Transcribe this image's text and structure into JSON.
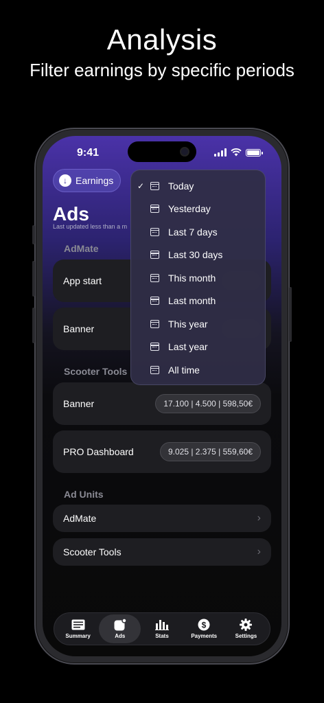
{
  "promo": {
    "title": "Analysis",
    "subtitle": "Filter earnings by specific periods"
  },
  "status": {
    "time": "9:41"
  },
  "header": {
    "filter_button": "Earnings",
    "title": "Ads",
    "updated": "Last updated less than a m"
  },
  "sections": {
    "admate": {
      "title": "AdMate",
      "rows": [
        {
          "label": "App start"
        },
        {
          "label": "Banner"
        }
      ]
    },
    "scooter": {
      "title": "Scooter Tools",
      "rows": [
        {
          "label": "Banner",
          "value": "17.100 | 4.500 | 598,50€"
        },
        {
          "label": "PRO Dashboard",
          "value": "9.025 | 2.375 | 559,60€"
        }
      ]
    },
    "ad_units": {
      "title": "Ad Units",
      "rows": [
        {
          "label": "AdMate"
        },
        {
          "label": "Scooter Tools"
        }
      ]
    }
  },
  "menu": {
    "selected": "Today",
    "items": [
      "Today",
      "Yesterday",
      "Last 7 days",
      "Last 30 days",
      "This month",
      "Last month",
      "This year",
      "Last year",
      "All time"
    ]
  },
  "tabs": [
    {
      "label": "Summary",
      "icon": "list-icon"
    },
    {
      "label": "Ads",
      "icon": "ads-icon",
      "active": true
    },
    {
      "label": "Stats",
      "icon": "bar-chart-icon"
    },
    {
      "label": "Payments",
      "icon": "dollar-icon"
    },
    {
      "label": "Settings",
      "icon": "gear-icon"
    }
  ],
  "colors": {
    "accent": "#4a32a8",
    "card": "#1e1e22",
    "background": "#000000"
  }
}
